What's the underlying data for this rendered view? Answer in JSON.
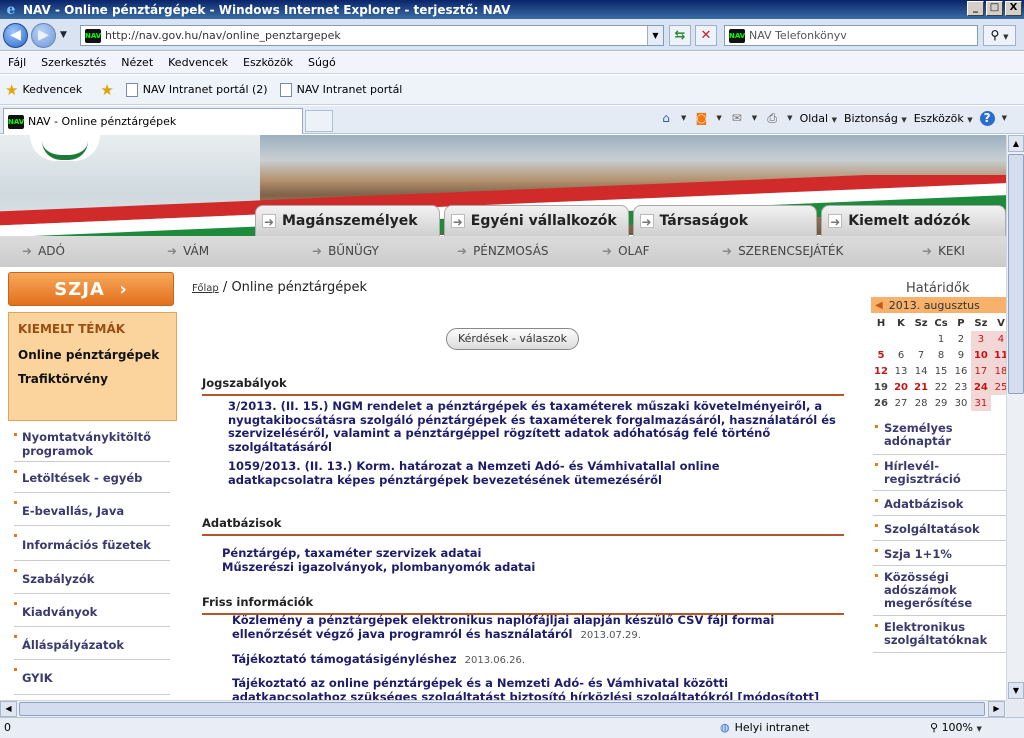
{
  "window": {
    "title": "NAV - Online pénztárgépek - Windows Internet Explorer - terjesztő: NAV",
    "buttons": [
      "_",
      "□",
      "X"
    ]
  },
  "address": {
    "url": "http://nav.gov.hu/nav/online_penztargepek",
    "search_placeholder": "NAV Telefonkönyv",
    "nav_logo": "NAV"
  },
  "menu": [
    "Fájl",
    "Szerkesztés",
    "Nézet",
    "Kedvencek",
    "Eszközök",
    "Súgó"
  ],
  "favorites": {
    "label": "Kedvencek",
    "items": [
      "NAV Intranet portál (2)",
      "NAV Intranet portál"
    ]
  },
  "tab": {
    "title": "NAV - Online pénztárgépek"
  },
  "commands": [
    "Oldal",
    "Biztonság",
    "Eszközök"
  ],
  "site": {
    "main_tabs": [
      "Magánszemélyek",
      "Egyéni vállalkozók",
      "Társaságok",
      "Kiemelt adózók"
    ],
    "subnav": [
      "ADÓ",
      "VÁM",
      "BŰNÜGY",
      "PÉNZMOSÁS",
      "OLAF",
      "SZERENCSEJÁTÉK",
      "KEKI"
    ],
    "szja_button": "SZJA",
    "kiemelt": {
      "heading": "KIEMELT TÉMÁK",
      "items": [
        "Online pénztárgépek",
        "Trafiktörvény"
      ]
    },
    "left_nav": [
      "Nyomtatványkitöltő programok",
      "Letöltések - egyéb",
      "E-bevallás, Java",
      "Információs füzetek",
      "Szabályzók",
      "Kiadványok",
      "Álláspályázatok",
      "GYIK"
    ],
    "breadcrumb": {
      "home": "Főlap",
      "sep": "/",
      "current": "Online pénztárgépek"
    },
    "qa_button": "Kérdések - válaszok",
    "sections": {
      "jog": {
        "heading": "Jogszabályok",
        "items": [
          "3/2013. (II. 15.) NGM rendelet a pénztárgépek és taxaméterek műszaki követelményeiről, a nyugtakibocsátásra szolgáló pénztárgépek és taxaméterek forgalmazásáról, használatáról és szervizeléséről, valamint a pénztárgéppel rögzített adatok adóhatóság felé történő szolgáltatásáról",
          "1059/2013. (II. 13.) Korm. határozat a Nemzeti Adó- és Vámhivatallal online adatkapcsolatra képes pénztárgépek bevezetésének ütemezéséről"
        ]
      },
      "adat": {
        "heading": "Adatbázisok",
        "items": [
          "Pénztárgép, taxaméter szervizek adatai",
          "Műszerészi igazolványok, plombanyomók adatai"
        ]
      },
      "friss": {
        "heading": "Friss információk",
        "items": [
          {
            "text": "Közlemény a pénztárgépek elektronikus naplófájljai alapján készülő CSV fájl formai ellenőrzését végző java programról és használatáról",
            "date": "2013.07.29."
          },
          {
            "text": "Tájékoztató támogatásigényléshez",
            "date": "2013.06.26."
          },
          {
            "text": "Tájékoztató az online pénztárgépek és a Nemzeti Adó- és Vámhivatal közötti adatkapcsolathoz szükséges szolgáltatást biztosító hírközlési szolgáltatókról [módosított]",
            "date": ""
          }
        ]
      }
    },
    "deadlines": {
      "title": "Határidők",
      "month": "2013. augusztus",
      "weekdays": [
        "H",
        "K",
        "Sz",
        "Cs",
        "P",
        "Sz",
        "V"
      ],
      "weeks": [
        [
          "",
          "",
          "",
          "1",
          "2",
          "3",
          "4"
        ],
        [
          "5",
          "6",
          "7",
          "8",
          "9",
          "10",
          "11"
        ],
        [
          "12",
          "13",
          "14",
          "15",
          "16",
          "17",
          "18"
        ],
        [
          "19",
          "20",
          "21",
          "22",
          "23",
          "24",
          "25"
        ],
        [
          "26",
          "27",
          "28",
          "29",
          "30",
          "31",
          ""
        ]
      ]
    },
    "right_nav": [
      "Személyes adónaptár",
      "Hírlevél-regisztráció",
      "Adatbázisok",
      "Szolgáltatások",
      "Szja 1+1%",
      "Közösségi adószámok megerősítése",
      "Elektronikus szolgáltatóknak"
    ]
  },
  "status": {
    "left": "0",
    "zone": "Helyi intranet",
    "zoom": "100%"
  }
}
